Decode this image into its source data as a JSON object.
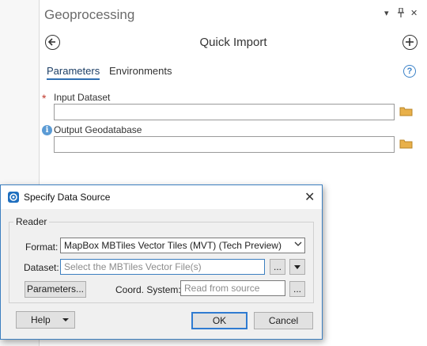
{
  "pane": {
    "title": "Geoprocessing",
    "controls": {
      "menu": "▾",
      "pin": "📌",
      "close": "✕"
    },
    "heading": "Quick Import",
    "back_icon": "arrow-left-circle-icon",
    "add_icon": "plus-circle-icon",
    "tabs": [
      "Parameters",
      "Environments"
    ],
    "help": "?",
    "params": [
      {
        "label": "Input Dataset",
        "required_mark": "*",
        "value": ""
      },
      {
        "label": "Output Geodatabase",
        "info_mark": "i",
        "value": ""
      }
    ]
  },
  "dialog": {
    "title": "Specify Data Source",
    "close": "✕",
    "group_label": "Reader",
    "format_label": "Format:",
    "format_value": "MapBox MBTiles Vector Tiles (MVT) (Tech Preview)",
    "dataset_label": "Dataset:",
    "dataset_placeholder": "Select the MBTiles Vector File(s)",
    "ellipsis": "...",
    "parameters_button": "Parameters...",
    "coord_label": "Coord. System:",
    "coord_placeholder": "Read from source",
    "help_button": "Help",
    "ok_button": "OK",
    "cancel_button": "Cancel"
  },
  "colors": {
    "accent": "#2f6fb3",
    "dialog_border": "#3c7fc0",
    "required": "#c0392b",
    "folder": "#e8b04a"
  }
}
